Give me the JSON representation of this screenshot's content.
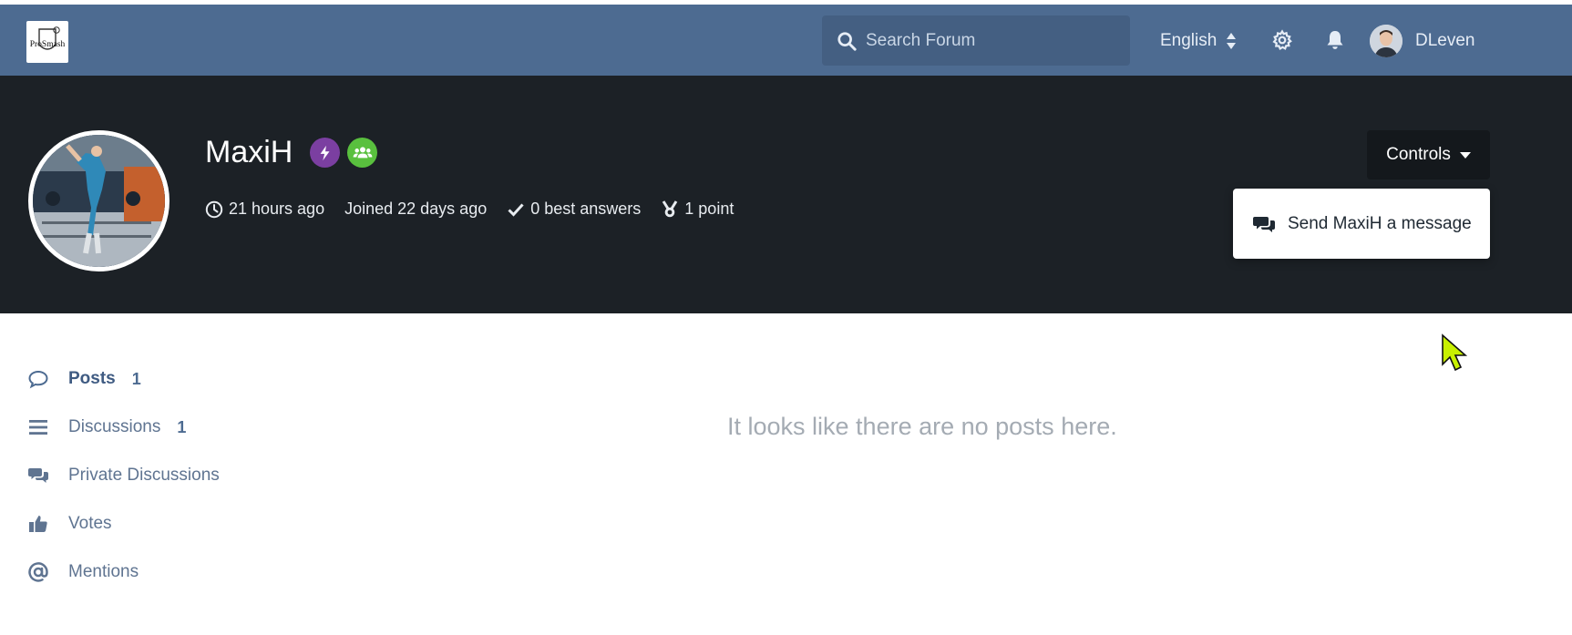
{
  "header": {
    "logo_text": "ProSmash",
    "search_placeholder": "Search Forum",
    "language": "English",
    "username": "DLeven",
    "icons": [
      "search-icon",
      "gear-icon",
      "bell-icon"
    ]
  },
  "profile": {
    "username": "MaxiH",
    "last_seen": "21 hours ago",
    "joined": "Joined 22 days ago",
    "best_answers": "0 best answers",
    "points": "1 point",
    "controls_label": "Controls",
    "dropdown_item": "Send MaxiH a message",
    "badges": [
      {
        "icon": "bolt-icon",
        "color": "#7b3fa1"
      },
      {
        "icon": "users-icon",
        "color": "#59c03e"
      }
    ]
  },
  "sidebar": {
    "items": [
      {
        "label": "Posts",
        "count": "1",
        "icon": "comment-icon",
        "active": true
      },
      {
        "label": "Discussions",
        "count": "1",
        "icon": "list-icon"
      },
      {
        "label": "Private Discussions",
        "count": "",
        "icon": "comments-icon"
      },
      {
        "label": "Votes",
        "count": "",
        "icon": "thumbs-up-icon"
      },
      {
        "label": "Mentions",
        "count": "",
        "icon": "at-icon"
      }
    ]
  },
  "main": {
    "empty_message": "It looks like there are no posts here."
  },
  "colors": {
    "header_bg": "#4d6b91",
    "hero_bg": "#1c2126",
    "accent": "#4d6b91",
    "cursor": "#c8f000"
  }
}
